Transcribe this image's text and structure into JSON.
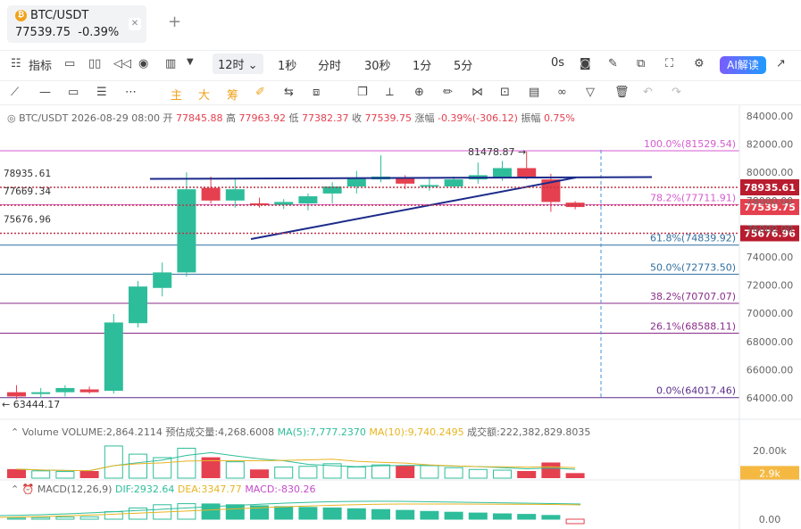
{
  "tab": {
    "symbol": "BTC/USDT",
    "price": "77539.75",
    "change": "-0.39%"
  },
  "toolbar": {
    "indicator": "指标",
    "interval_selected": "12时",
    "intervals": [
      "1秒",
      "分时",
      "30秒",
      "1分",
      "5分"
    ],
    "countdown": "0s",
    "ai_label": "AI解读"
  },
  "drawing": {
    "main": "主",
    "big": "大",
    "chip": "筹"
  },
  "info": {
    "symbol": "BTC/USDT",
    "datetime": "2026-08-29 08:00",
    "open_label": "开",
    "open": "77845.88",
    "high_label": "高",
    "high": "77963.92",
    "low_label": "低",
    "low": "77382.37",
    "close_label": "收",
    "close": "77539.75",
    "chg_label": "涨幅",
    "chg": "-0.39%(-306.12)",
    "amp_label": "振幅",
    "amp": "0.75%"
  },
  "price_axis": [
    "84000.00",
    "82000.00",
    "80000.00",
    "78000.00",
    "76000.00",
    "74000.00",
    "72000.00",
    "70000.00",
    "68000.00",
    "66000.00",
    "64000.00"
  ],
  "fib_levels": [
    {
      "label": "100.0%(81529.54)",
      "value": 81529.54,
      "color": "#d65bd0"
    },
    {
      "label": "78.2%(77711.91)",
      "value": 77711.91,
      "color": "#d65bd0"
    },
    {
      "label": "61.8%(74839.92)",
      "value": 74839.92,
      "color": "#2f6f9f"
    },
    {
      "label": "50.0%(72773.50)",
      "value": 72773.5,
      "color": "#2f6f9f"
    },
    {
      "label": "38.2%(70707.07)",
      "value": 70707.07,
      "color": "#8a2d8a"
    },
    {
      "label": "26.1%(68588.11)",
      "value": 68588.11,
      "color": "#8a2d8a"
    },
    {
      "label": "0.0%(64017.46)",
      "value": 64017.46,
      "color": "#5b2d8a"
    }
  ],
  "price_lines": [
    {
      "label": "78935.61",
      "value": 78935.61,
      "tag": "78935.61",
      "tag_color": "#b81c2e"
    },
    {
      "label": "77669.34",
      "value": 77669.34,
      "tag": "77539.75",
      "tag_color": "#e5404f"
    },
    {
      "label": "75676.96",
      "value": 75676.96,
      "tag": "75676.96",
      "tag_color": "#b81c2e"
    }
  ],
  "high_marker": "81478.87",
  "low_marker": "63444.17",
  "candles": [
    [
      64400,
      64900,
      63900,
      64100
    ],
    [
      64300,
      64700,
      64000,
      64400
    ],
    [
      64400,
      64900,
      64100,
      64700
    ],
    [
      64600,
      64800,
      64300,
      64400
    ],
    [
      64500,
      69950,
      64300,
      69350
    ],
    [
      69300,
      72300,
      69000,
      71900
    ],
    [
      71800,
      73600,
      71200,
      72900
    ],
    [
      72900,
      80000,
      72600,
      78800
    ],
    [
      78900,
      79700,
      77800,
      78000
    ],
    [
      78000,
      79500,
      77500,
      78800
    ],
    [
      77800,
      78200,
      77500,
      77750
    ],
    [
      77700,
      78100,
      77400,
      77900
    ],
    [
      77800,
      78500,
      77300,
      78300
    ],
    [
      78500,
      79300,
      77800,
      79000
    ],
    [
      79000,
      80100,
      78500,
      79600
    ],
    [
      79500,
      81200,
      79300,
      79700
    ],
    [
      79600,
      79800,
      78800,
      79200
    ],
    [
      79100,
      79600,
      78700,
      79100
    ],
    [
      79000,
      79700,
      78900,
      79500
    ],
    [
      79500,
      80700,
      79200,
      79800
    ],
    [
      79600,
      80800,
      79400,
      80300
    ],
    [
      80300,
      81478,
      79500,
      79600
    ],
    [
      79500,
      79900,
      77200,
      77900
    ],
    [
      77850,
      77960,
      77380,
      77540
    ]
  ],
  "volume": {
    "label": "Volume",
    "volume_label": "VOLUME:2,864.2114",
    "est_label": "预估成交量:4,268.6008",
    "ma5_label": "MA(5):7,777.2370",
    "ma10_label": "MA(10):9,740.2495",
    "turnover_label": "成交额:222,382,829.8035",
    "axis_top": "20.00k",
    "tag": "2.9k",
    "values": [
      5200,
      4200,
      3800,
      4100,
      18500,
      13800,
      11800,
      17200,
      12000,
      9400,
      5000,
      6400,
      6800,
      8300,
      6400,
      7600,
      7400,
      7200,
      6000,
      5000,
      4600,
      4100,
      9000,
      2900
    ]
  },
  "macd": {
    "label": "MACD(12,26,9)",
    "dif_label": "DIF:2932.64",
    "dea_label": "DEA:3347.77",
    "macd_label": "MACD:-830.26",
    "axis_zero": "0.00",
    "values": [
      200,
      300,
      400,
      450,
      1400,
      2100,
      2700,
      2900,
      2850,
      2700,
      2500,
      2350,
      2200,
      2100,
      1950,
      1800,
      1650,
      1450,
      1300,
      1150,
      1000,
      900,
      700,
      -830
    ]
  },
  "colors": {
    "up": "#2ebd9a",
    "down": "#e5404f",
    "trend": "#1b2a8a"
  }
}
